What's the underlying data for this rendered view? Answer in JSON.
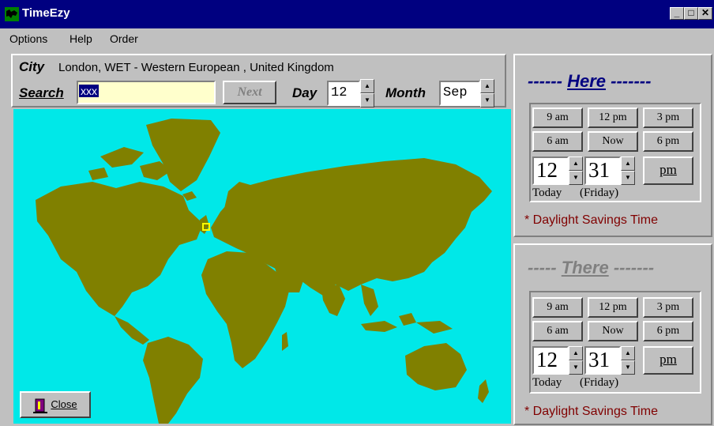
{
  "window": {
    "title": "TimeEzy"
  },
  "menu": {
    "items": [
      "Options",
      "Help",
      "Order"
    ]
  },
  "city": {
    "label": "City",
    "value": "London, WET - Western European , United Kingdom"
  },
  "search": {
    "label": "Search",
    "value": "xxx",
    "next_label": "Next"
  },
  "date": {
    "day_label": "Day",
    "day_value": "12",
    "month_label": "Month",
    "month_value": "Sep"
  },
  "map": {
    "ocean_color": "#00e8e8",
    "land_color": "#808000",
    "marker_city": "London"
  },
  "close_button": {
    "label": "Close"
  },
  "here": {
    "title_dashes_left": "------",
    "title": "Here",
    "title_dashes_right": "-------",
    "buttons": [
      "9 am",
      "12 pm",
      "3 pm",
      "6 am",
      "Now",
      "6 pm"
    ],
    "hour": "12",
    "minute": "31",
    "ampm": "pm",
    "day_text": "Today",
    "weekday_text": "(Friday)",
    "dst_text": "* Daylight Savings Time"
  },
  "there": {
    "title_dashes_left": "-----",
    "title": "There",
    "title_dashes_right": "-------",
    "buttons": [
      "9 am",
      "12 pm",
      "3 pm",
      "6 am",
      "Now",
      "6 pm"
    ],
    "hour": "12",
    "minute": "31",
    "ampm": "pm",
    "day_text": "Today",
    "weekday_text": "(Friday)",
    "dst_text": "* Daylight Savings Time"
  }
}
